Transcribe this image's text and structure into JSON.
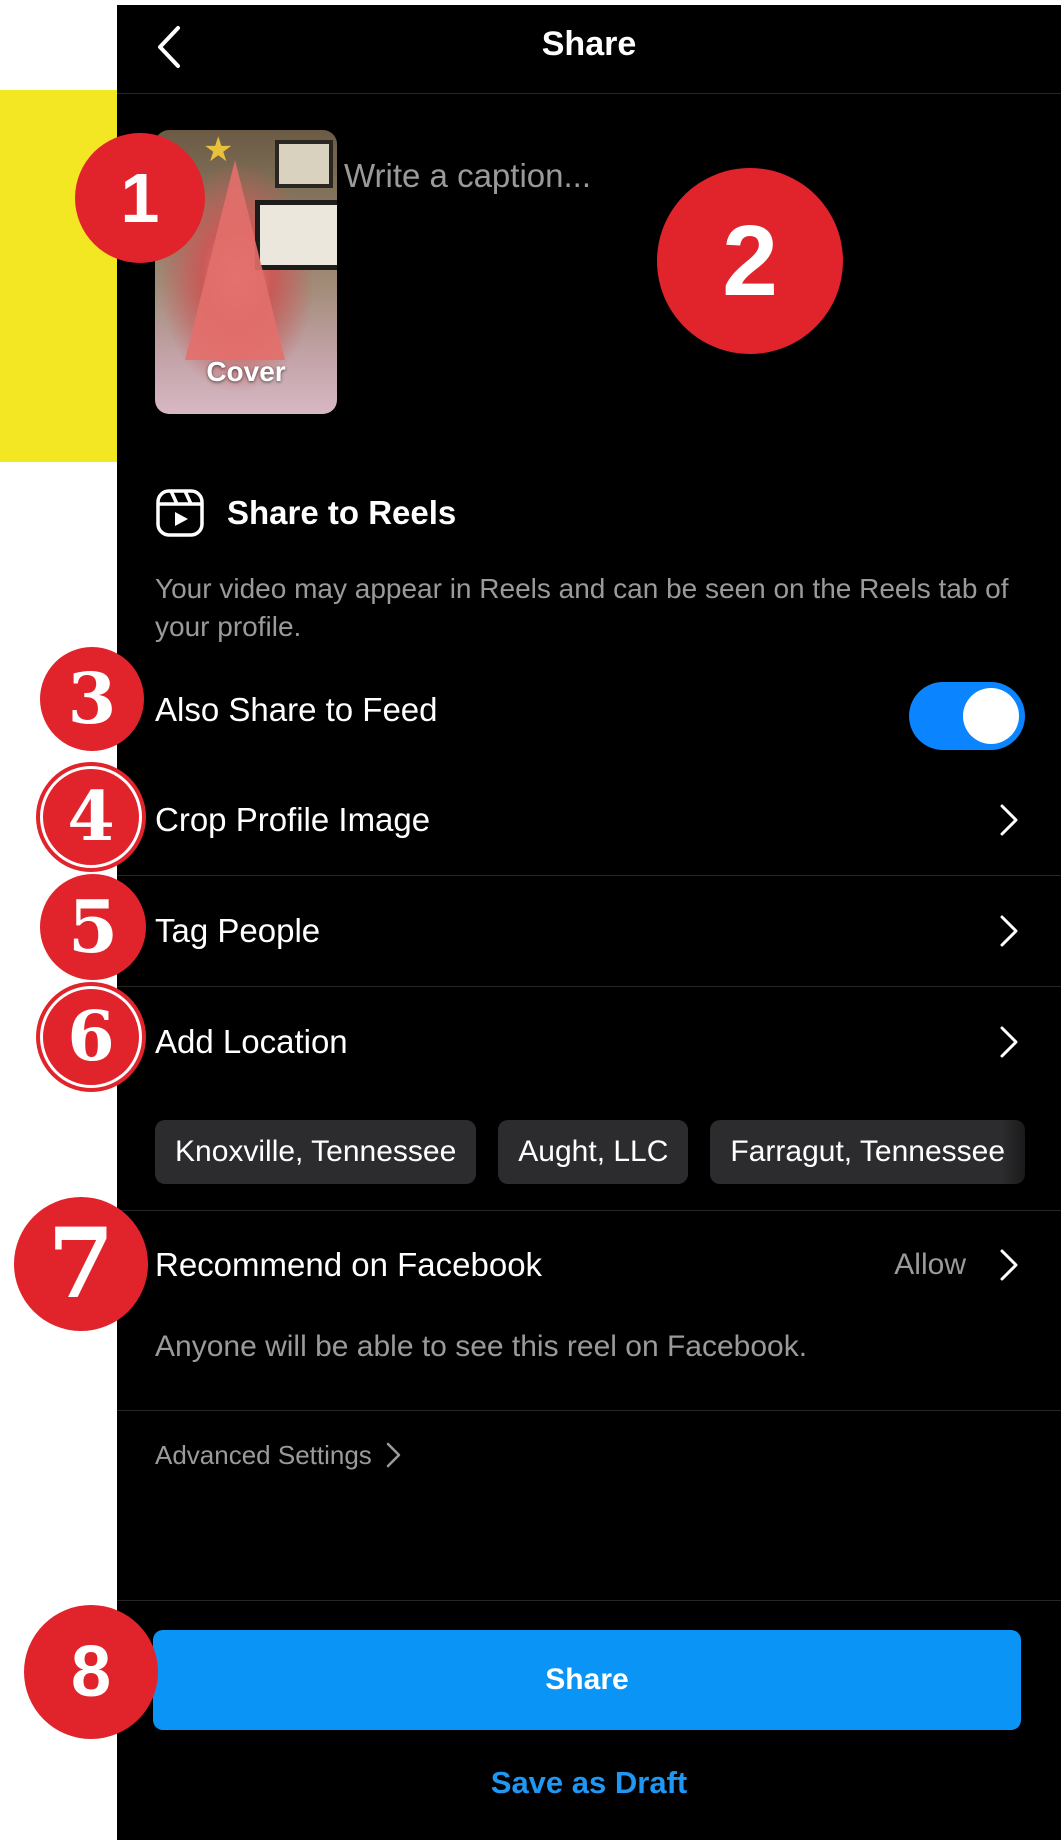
{
  "header": {
    "title": "Share"
  },
  "cover": {
    "label": "Cover"
  },
  "caption": {
    "placeholder": "Write a caption..."
  },
  "reels": {
    "label": "Share to Reels",
    "description": "Your video may appear in Reels and can be seen on the Reels tab of your profile."
  },
  "settings": {
    "feed_label": "Also Share to Feed",
    "feed_enabled": true,
    "crop_label": "Crop Profile Image",
    "tag_label": "Tag People",
    "location_label": "Add Location"
  },
  "location_suggestions": [
    "Knoxville, Tennessee",
    "Aught, LLC",
    "Farragut, Tennessee"
  ],
  "facebook": {
    "label": "Recommend on Facebook",
    "value": "Allow",
    "description": "Anyone will be able to see this reel on Facebook."
  },
  "advanced": {
    "label": "Advanced Settings"
  },
  "actions": {
    "share_label": "Share",
    "draft_label": "Save as Draft"
  },
  "badges": [
    "1",
    "2",
    "3",
    "4",
    "5",
    "6",
    "7",
    "8"
  ],
  "colors": {
    "accent": "#0a95f6",
    "toggle": "#0a84ff",
    "badge": "#e1242b",
    "highlight": "#f3e724"
  }
}
